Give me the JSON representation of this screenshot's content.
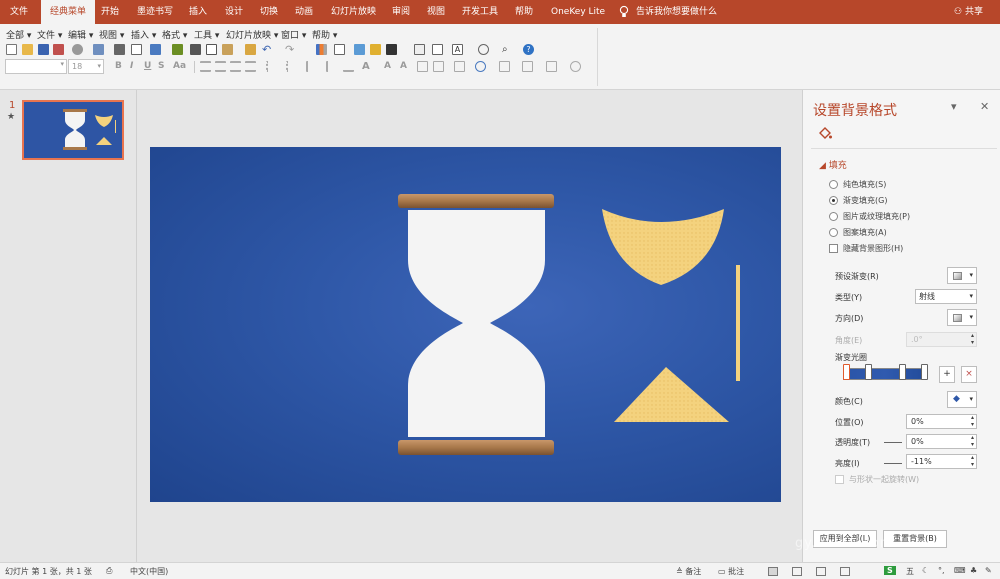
{
  "ribbon": {
    "tabs": [
      {
        "label": "文件"
      },
      {
        "label": "经典菜单",
        "active": true
      },
      {
        "label": "开始"
      },
      {
        "label": "墨迹书写"
      },
      {
        "label": "插入"
      },
      {
        "label": "设计"
      },
      {
        "label": "切换"
      },
      {
        "label": "动画"
      },
      {
        "label": "幻灯片放映"
      },
      {
        "label": "审阅"
      },
      {
        "label": "视图"
      },
      {
        "label": "开发工具"
      },
      {
        "label": "帮助"
      },
      {
        "label": "OneKey Lite"
      }
    ],
    "tell_me": "告诉我你想要做什么",
    "share": "共享",
    "accent_color": "#b7472a"
  },
  "menubar": {
    "items": [
      "全部",
      "文件",
      "编辑",
      "视图",
      "插入",
      "格式",
      "工具",
      "幻灯片放映",
      "窗口",
      "帮助"
    ]
  },
  "font": {
    "name": "",
    "size": "18"
  },
  "thumbnail": {
    "slide_number": "1",
    "star": "★"
  },
  "format_pane": {
    "title": "设置背景格式",
    "fill_section": "填充",
    "options": [
      {
        "label": "纯色填充(S)",
        "type": "radio",
        "selected": false
      },
      {
        "label": "渐变填充(G)",
        "type": "radio",
        "selected": true
      },
      {
        "label": "图片或纹理填充(P)",
        "type": "radio",
        "selected": false
      },
      {
        "label": "图案填充(A)",
        "type": "radio",
        "selected": false
      },
      {
        "label": "隐藏背景图形(H)",
        "type": "checkbox",
        "selected": false
      }
    ],
    "preset_label": "预设渐变(R)",
    "type_label": "类型(Y)",
    "type_value": "射线",
    "direction_label": "方向(D)",
    "angle_label": "角度(E)",
    "angle_value": ".0°",
    "stops_label": "渐变光圈",
    "color_label": "颜色(C)",
    "position_label": "位置(O)",
    "position_value": "0%",
    "transparency_label": "透明度(T)",
    "transparency_value": "0%",
    "brightness_label": "亮度(I)",
    "brightness_value": "-11%",
    "rotate_label": "与形状一起旋转(W)",
    "apply_all": "应用到全部(L)",
    "reset": "重置背景(B)"
  },
  "statusbar": {
    "slide_info": "幻灯片 第 1 张，共 1 张",
    "language": "中文(中国)",
    "notes": "备注",
    "comments": "批注"
  },
  "watermark": "gy.baidu.com",
  "colors": {
    "slide_bg": "#2f58a8",
    "wood": "#a8784a",
    "sand": "#f4d27e",
    "glass": "#f4f4f4"
  }
}
